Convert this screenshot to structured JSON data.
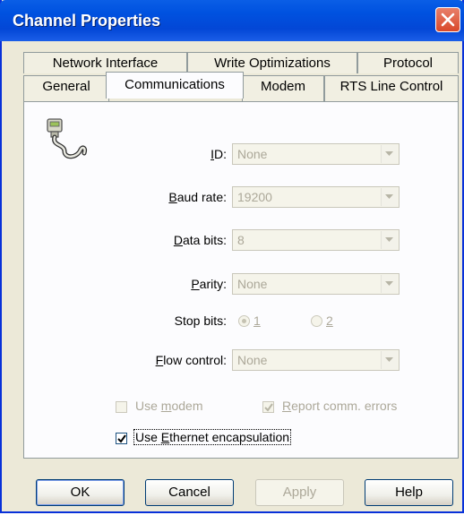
{
  "window": {
    "title": "Channel Properties",
    "close_icon": "close-x-icon"
  },
  "tabs_row1": [
    {
      "label": "Network Interface"
    },
    {
      "label": "Write Optimizations"
    },
    {
      "label": "Protocol"
    }
  ],
  "tabs_row2": [
    {
      "label": "General"
    },
    {
      "label": "Communications",
      "active": true
    },
    {
      "label": "Modem"
    },
    {
      "label": "RTS Line Control"
    }
  ],
  "panel": {
    "icon": "serial-cable-icon",
    "id": {
      "label": "ID:",
      "mnemonic": "I",
      "value": "None"
    },
    "baud_rate": {
      "label": "Baud rate:",
      "mnemonic": "B",
      "value": "19200"
    },
    "data_bits": {
      "label": "Data bits:",
      "mnemonic": "D",
      "value": "8"
    },
    "parity": {
      "label": "Parity:",
      "mnemonic": "P",
      "value": "None"
    },
    "stop_bits": {
      "label": "Stop bits:",
      "options": [
        "1",
        "2"
      ],
      "selected": "1"
    },
    "flow_control": {
      "label": "Flow control:",
      "mnemonic": "F",
      "value": "None"
    },
    "use_modem": {
      "label": "Use modem",
      "checked": false,
      "enabled": false
    },
    "report_errors": {
      "label": "Report comm. errors",
      "checked": true,
      "enabled": false
    },
    "use_ethernet": {
      "label": "Use Ethernet encapsulation",
      "checked": true,
      "enabled": true
    }
  },
  "buttons": {
    "ok": "OK",
    "cancel": "Cancel",
    "apply": "Apply",
    "help": "Help"
  }
}
